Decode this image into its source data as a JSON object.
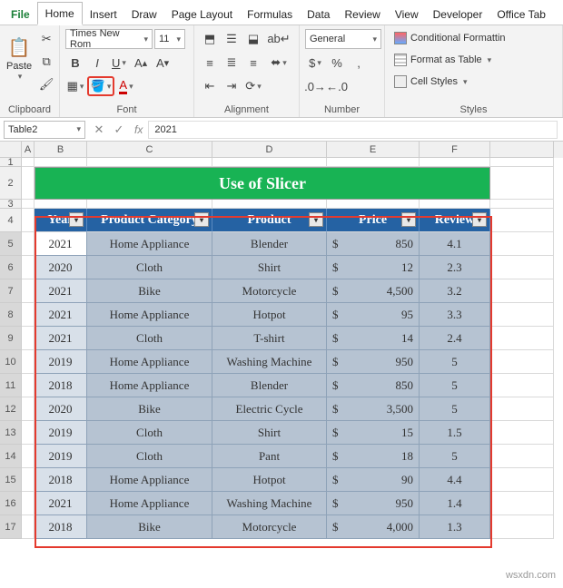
{
  "tabs": {
    "file": "File",
    "home": "Home",
    "insert": "Insert",
    "draw": "Draw",
    "page": "Page Layout",
    "formulas": "Formulas",
    "data": "Data",
    "review": "Review",
    "view": "View",
    "developer": "Developer",
    "office": "Office Tab"
  },
  "ribbon": {
    "clipboard": {
      "paste": "Paste",
      "label": "Clipboard"
    },
    "font": {
      "name": "Times New Rom",
      "size": "11",
      "label": "Font"
    },
    "alignment": {
      "label": "Alignment"
    },
    "number": {
      "format": "General",
      "label": "Number"
    },
    "styles": {
      "cond": "Conditional Formattin",
      "table": "Format as Table",
      "cell": "Cell Styles",
      "label": "Styles"
    }
  },
  "namebox": "Table2",
  "formula": "2021",
  "cols": [
    "A",
    "B",
    "C",
    "D",
    "E",
    "F"
  ],
  "rows": [
    "1",
    "2",
    "3",
    "4",
    "5",
    "6",
    "7",
    "8",
    "9",
    "10",
    "11",
    "12",
    "13",
    "14",
    "15",
    "16",
    "17"
  ],
  "title": "Use of Slicer",
  "headers": {
    "year": "Year",
    "cat": "Product Category",
    "prod": "Product",
    "price": "Price",
    "rev": "Review"
  },
  "data": [
    {
      "y": "2021",
      "c": "Home Appliance",
      "p": "Blender",
      "pr": "850",
      "r": "4.1"
    },
    {
      "y": "2020",
      "c": "Cloth",
      "p": "Shirt",
      "pr": "12",
      "r": "2.3"
    },
    {
      "y": "2021",
      "c": "Bike",
      "p": "Motorcycle",
      "pr": "4,500",
      "r": "3.2"
    },
    {
      "y": "2021",
      "c": "Home Appliance",
      "p": "Hotpot",
      "pr": "95",
      "r": "3.3"
    },
    {
      "y": "2021",
      "c": "Cloth",
      "p": "T-shirt",
      "pr": "14",
      "r": "2.4"
    },
    {
      "y": "2019",
      "c": "Home Appliance",
      "p": "Washing Machine",
      "pr": "950",
      "r": "5"
    },
    {
      "y": "2018",
      "c": "Home Appliance",
      "p": "Blender",
      "pr": "850",
      "r": "5"
    },
    {
      "y": "2020",
      "c": "Bike",
      "p": "Electric Cycle",
      "pr": "3,500",
      "r": "5"
    },
    {
      "y": "2019",
      "c": "Cloth",
      "p": "Shirt",
      "pr": "15",
      "r": "1.5"
    },
    {
      "y": "2019",
      "c": "Cloth",
      "p": "Pant",
      "pr": "18",
      "r": "5"
    },
    {
      "y": "2018",
      "c": "Home Appliance",
      "p": "Hotpot",
      "pr": "90",
      "r": "4.4"
    },
    {
      "y": "2021",
      "c": "Home Appliance",
      "p": "Washing Machine",
      "pr": "950",
      "r": "1.4"
    },
    {
      "y": "2018",
      "c": "Bike",
      "p": "Motorcycle",
      "pr": "4,000",
      "r": "1.3"
    }
  ],
  "currency": "$",
  "watermark": "wsxdn.com"
}
